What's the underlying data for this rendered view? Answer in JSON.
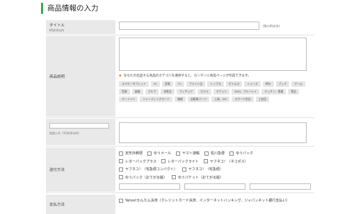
{
  "section": {
    "title": "商品情報の入力"
  },
  "title_row": {
    "label": "タイトル",
    "sublabel": "65文字以内",
    "hint": "(残り65文字)"
  },
  "desc_row": {
    "label": "商品説明",
    "note": "あなたの出品する商品のカテゴリを選択すると、カンタンに商品ページが作成できます。",
    "tags": [
      "スマホ／タブレット",
      "PC",
      "家電",
      "TV",
      "ブランド品",
      "トップス",
      "ボトムス",
      "シューズ",
      "時計",
      "ブック",
      "ゲーム",
      "音楽",
      "楽器",
      "ゴルフ",
      "化粧品",
      "フィギュア",
      "カメラ",
      "チケット",
      "DVD、ブルーレイ",
      "キッチン、食器",
      "食品",
      "オートバイ",
      "トレーディングカード",
      "雑貨",
      "自動車パーツ",
      "工具、DIY",
      "スポーツ用品",
      "工芸品"
    ]
  },
  "free_row": {
    "label": "自由入力（15文字以内）"
  },
  "shipping_row": {
    "label": "送付方法",
    "lines": [
      [
        "定形外郵便",
        "ゆうメール",
        "ヤマト運輸",
        "佐川急便",
        "ゆうパック"
      ],
      [
        "レターパックプラス",
        "レターパックライト",
        "ヤフネコ！（ネコポス）"
      ],
      [
        "ヤフネコ！（宅急便コンパクト）",
        "ヤフネコ！（宅急便）"
      ],
      [
        "ゆうパック（おてがる版）",
        "ゆうパケット（おてがる版）"
      ]
    ]
  },
  "payment_row": {
    "label": "支払方法",
    "option": "Yahoo!かんたん決済（クレジットカード決済、インターネットバンキング、ジャパンネット銀行支払い）"
  }
}
